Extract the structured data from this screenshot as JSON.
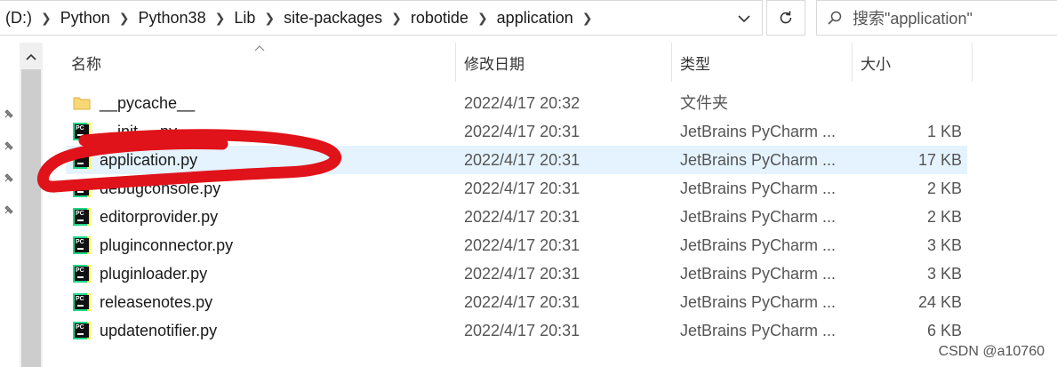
{
  "address": {
    "breadcrumbs": [
      "(D:)",
      "Python",
      "Python38",
      "Lib",
      "site-packages",
      "robotide",
      "application"
    ]
  },
  "search": {
    "placeholder": "搜索\"application\""
  },
  "columns": {
    "name": "名称",
    "date": "修改日期",
    "type": "类型",
    "size": "大小"
  },
  "files": [
    {
      "name": "__pycache__",
      "date": "2022/4/17 20:32",
      "type": "文件夹",
      "size": "",
      "icon": "folder-icon"
    },
    {
      "name": "__init__.py",
      "date": "2022/4/17 20:31",
      "type": "JetBrains PyCharm ...",
      "size": "1 KB",
      "icon": "pycharm-file-icon"
    },
    {
      "name": "application.py",
      "date": "2022/4/17 20:31",
      "type": "JetBrains PyCharm ...",
      "size": "17 KB",
      "icon": "pycharm-file-icon",
      "selected": true
    },
    {
      "name": "debugconsole.py",
      "date": "2022/4/17 20:31",
      "type": "JetBrains PyCharm ...",
      "size": "2 KB",
      "icon": "pycharm-file-icon"
    },
    {
      "name": "editorprovider.py",
      "date": "2022/4/17 20:31",
      "type": "JetBrains PyCharm ...",
      "size": "2 KB",
      "icon": "pycharm-file-icon"
    },
    {
      "name": "pluginconnector.py",
      "date": "2022/4/17 20:31",
      "type": "JetBrains PyCharm ...",
      "size": "3 KB",
      "icon": "pycharm-file-icon"
    },
    {
      "name": "pluginloader.py",
      "date": "2022/4/17 20:31",
      "type": "JetBrains PyCharm ...",
      "size": "3 KB",
      "icon": "pycharm-file-icon"
    },
    {
      "name": "releasenotes.py",
      "date": "2022/4/17 20:31",
      "type": "JetBrains PyCharm ...",
      "size": "24 KB",
      "icon": "pycharm-file-icon"
    },
    {
      "name": "updatenotifier.py",
      "date": "2022/4/17 20:31",
      "type": "JetBrains PyCharm ...",
      "size": "6 KB",
      "icon": "pycharm-file-icon"
    }
  ],
  "watermark": "CSDN @a10760",
  "colors": {
    "selection": "#e5f3ff",
    "annotation": "#e0121a",
    "pycharm_green": "#21d789"
  }
}
